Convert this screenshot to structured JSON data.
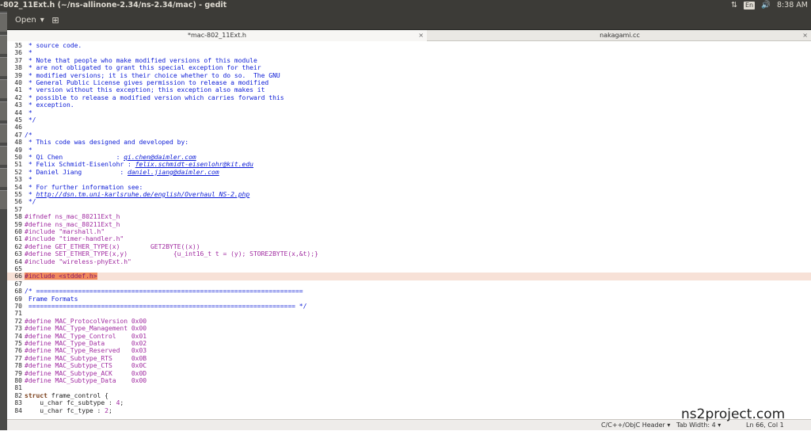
{
  "window": {
    "title": "-802_11Ext.h (~/ns-allinone-2.34/ns-2.34/mac) - gedit"
  },
  "tray": {
    "keyboard": "En",
    "time": "8:38 AM"
  },
  "toolbar": {
    "open_label": "Open"
  },
  "tabs": [
    {
      "label": "*mac-802_11Ext.h",
      "active": true
    },
    {
      "label": "nakagami.cc",
      "active": false
    }
  ],
  "editor": {
    "current_line": 66,
    "lines": [
      {
        "n": "35",
        "t": " * source code.",
        "c": "cm"
      },
      {
        "n": "36",
        "t": " *",
        "c": "cm"
      },
      {
        "n": "37",
        "t": " * Note that people who make modified versions of this module",
        "c": "cm"
      },
      {
        "n": "38",
        "t": " * are not obligated to grant this special exception for their",
        "c": "cm"
      },
      {
        "n": "39",
        "t": " * modified versions; it is their choice whether to do so.  The GNU",
        "c": "cm"
      },
      {
        "n": "40",
        "t": " * General Public License gives permission to release a modified",
        "c": "cm"
      },
      {
        "n": "41",
        "t": " * version without this exception; this exception also makes it",
        "c": "cm"
      },
      {
        "n": "42",
        "t": " * possible to release a modified version which carries forward this",
        "c": "cm"
      },
      {
        "n": "43",
        "t": " * exception.",
        "c": "cm"
      },
      {
        "n": "44",
        "t": " *",
        "c": "cm"
      },
      {
        "n": "45",
        "t": " */",
        "c": "cm"
      },
      {
        "n": "46",
        "t": "",
        "c": "tx"
      },
      {
        "n": "47",
        "t": "/*",
        "c": "cm"
      },
      {
        "n": "48",
        "t": " * This code was designed and developed by:",
        "c": "cm"
      },
      {
        "n": "49",
        "t": " *",
        "c": "cm"
      },
      {
        "n": "50",
        "t": " * Qi Chen              : ",
        "c": "cm",
        "link": "qi.chen@daimler.com"
      },
      {
        "n": "51",
        "t": " * Felix Schmidt-Eisenlohr : ",
        "c": "cm",
        "link": "felix.schmidt-eisenlohr@kit.edu"
      },
      {
        "n": "52",
        "t": " * Daniel Jiang          : ",
        "c": "cm",
        "link": "daniel.jiang@daimler.com"
      },
      {
        "n": "53",
        "t": " *",
        "c": "cm"
      },
      {
        "n": "54",
        "t": " * For further information see:",
        "c": "cm"
      },
      {
        "n": "55",
        "t": " * ",
        "c": "cm",
        "link": "http://dsn.tm.uni-karlsruhe.de/english/Overhaul_NS-2.php"
      },
      {
        "n": "56",
        "t": " */",
        "c": "cm"
      },
      {
        "n": "57",
        "t": "",
        "c": "tx"
      },
      {
        "n": "58",
        "t": "#ifndef ns_mac_80211Ext_h",
        "c": "pp"
      },
      {
        "n": "59",
        "t": "#define ns_mac_80211Ext_h",
        "c": "pp"
      },
      {
        "n": "60",
        "t": "#include \"marshall.h\"",
        "c": "pp"
      },
      {
        "n": "61",
        "t": "#include \"timer-handler.h\"",
        "c": "pp"
      },
      {
        "n": "62",
        "t": "#define GET_ETHER_TYPE(x)        GET2BYTE((x))",
        "c": "pp"
      },
      {
        "n": "63",
        "t": "#define SET_ETHER_TYPE(x,y)            {u_int16_t t = (y); STORE2BYTE(x,&t);}",
        "c": "pp"
      },
      {
        "n": "64",
        "t": "#include \"wireless-phyExt.h\"",
        "c": "pp"
      },
      {
        "n": "65",
        "t": "",
        "c": "tx"
      },
      {
        "n": "66",
        "t": "#include <stddef.h>",
        "c": "hl"
      },
      {
        "n": "67",
        "t": "",
        "c": "tx"
      },
      {
        "n": "68",
        "t": "/* ======================================================================",
        "c": "cm"
      },
      {
        "n": "69",
        "t": " Frame Formats",
        "c": "cm"
      },
      {
        "n": "70",
        "t": " ====================================================================== */",
        "c": "cm"
      },
      {
        "n": "71",
        "t": "",
        "c": "tx"
      },
      {
        "n": "72",
        "t": "#define MAC_ProtocolVersion 0x00",
        "c": "pp"
      },
      {
        "n": "73",
        "t": "#define MAC_Type_Management 0x00",
        "c": "pp"
      },
      {
        "n": "74",
        "t": "#define MAC_Type_Control    0x01",
        "c": "pp"
      },
      {
        "n": "75",
        "t": "#define MAC_Type_Data       0x02",
        "c": "pp"
      },
      {
        "n": "76",
        "t": "#define MAC_Type_Reserved   0x03",
        "c": "pp"
      },
      {
        "n": "77",
        "t": "#define MAC_Subtype_RTS     0x0B",
        "c": "pp"
      },
      {
        "n": "78",
        "t": "#define MAC_Subtype_CTS     0x0C",
        "c": "pp"
      },
      {
        "n": "79",
        "t": "#define MAC_Subtype_ACK     0x0D",
        "c": "pp"
      },
      {
        "n": "80",
        "t": "#define MAC_Subtype_Data    0x00",
        "c": "pp"
      },
      {
        "n": "81",
        "t": "",
        "c": "tx"
      },
      {
        "n": "82",
        "t": "struct frame_control {",
        "c": "struct"
      },
      {
        "n": "83",
        "t": "    u_char fc_subtype : 4;",
        "c": "field",
        "num": "4"
      },
      {
        "n": "84",
        "t": "    u_char fc_type : 2;",
        "c": "field",
        "num": "2"
      }
    ]
  },
  "statusbar": {
    "language": "C/C++/ObjC Header",
    "tab_width": "Tab Width: 4",
    "position": "Ln 66, Col 1"
  },
  "watermark": "ns2project.com"
}
